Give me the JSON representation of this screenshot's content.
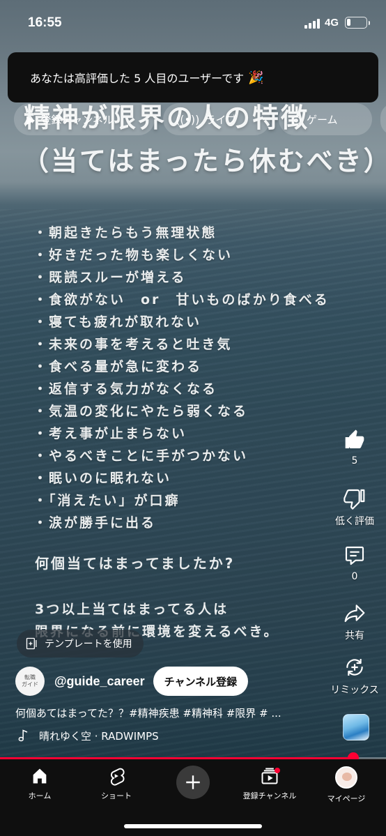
{
  "status_bar": {
    "time": "16:55",
    "network": "4G",
    "battery_level": 0.2
  },
  "toast": {
    "text": "あなたは高評価した 5 人目のユーザーです",
    "emoji": "🎉"
  },
  "chips": [
    {
      "label": "登録チャンネル",
      "icon": "subscriptions-icon"
    },
    {
      "label": "ライブ",
      "icon": "live-icon"
    },
    {
      "label": "ゲーム",
      "icon": "gaming-icon"
    }
  ],
  "video": {
    "title_line1": "精神が限界の人の特徴",
    "title_line2": "（当てはまったら休むべき）",
    "bullets": [
      "・朝起きたらもう無理状態",
      "・好きだった物も楽しくない",
      "・既読スルーが増える",
      "・食欲がない　or　甘いものばかり食べる",
      "・寝ても疲れが取れない",
      "・未来の事を考えると吐き気",
      "・食べる量が急に変わる",
      "・返信する気力がなくなる",
      "・気温の変化にやたら弱くなる",
      "・考え事が止まらない",
      "・やるべきことに手がつかない",
      "・眠いのに眠れない",
      "・「消えたい」が口癖",
      "・涙が勝手に出る"
    ],
    "question": "何個当てはまってましたか?",
    "footnote_line1": "3つ以上当てはまってる人は",
    "footnote_line2": "限界になる前に環境を変えるべき。"
  },
  "actions": {
    "like_count": "5",
    "dislike_label": "低く評価",
    "comment_count": "0",
    "share_label": "共有",
    "remix_label": "リミックス"
  },
  "template_button": {
    "label": "テンプレートを使用"
  },
  "channel": {
    "avatar_text": "転職\nガイド",
    "handle": "@guide_career",
    "subscribe_label": "チャンネル登録"
  },
  "caption": "何個あてはまってた？？#精神疾患 #精神科 #限界 # ...",
  "music": {
    "label": "晴れゆく空 · RADWIMPS"
  },
  "playback": {
    "progress": 0.915
  },
  "bottom_nav": {
    "home": "ホーム",
    "shorts": "ショート",
    "subscriptions": "登録チャンネル",
    "you": "マイページ"
  }
}
